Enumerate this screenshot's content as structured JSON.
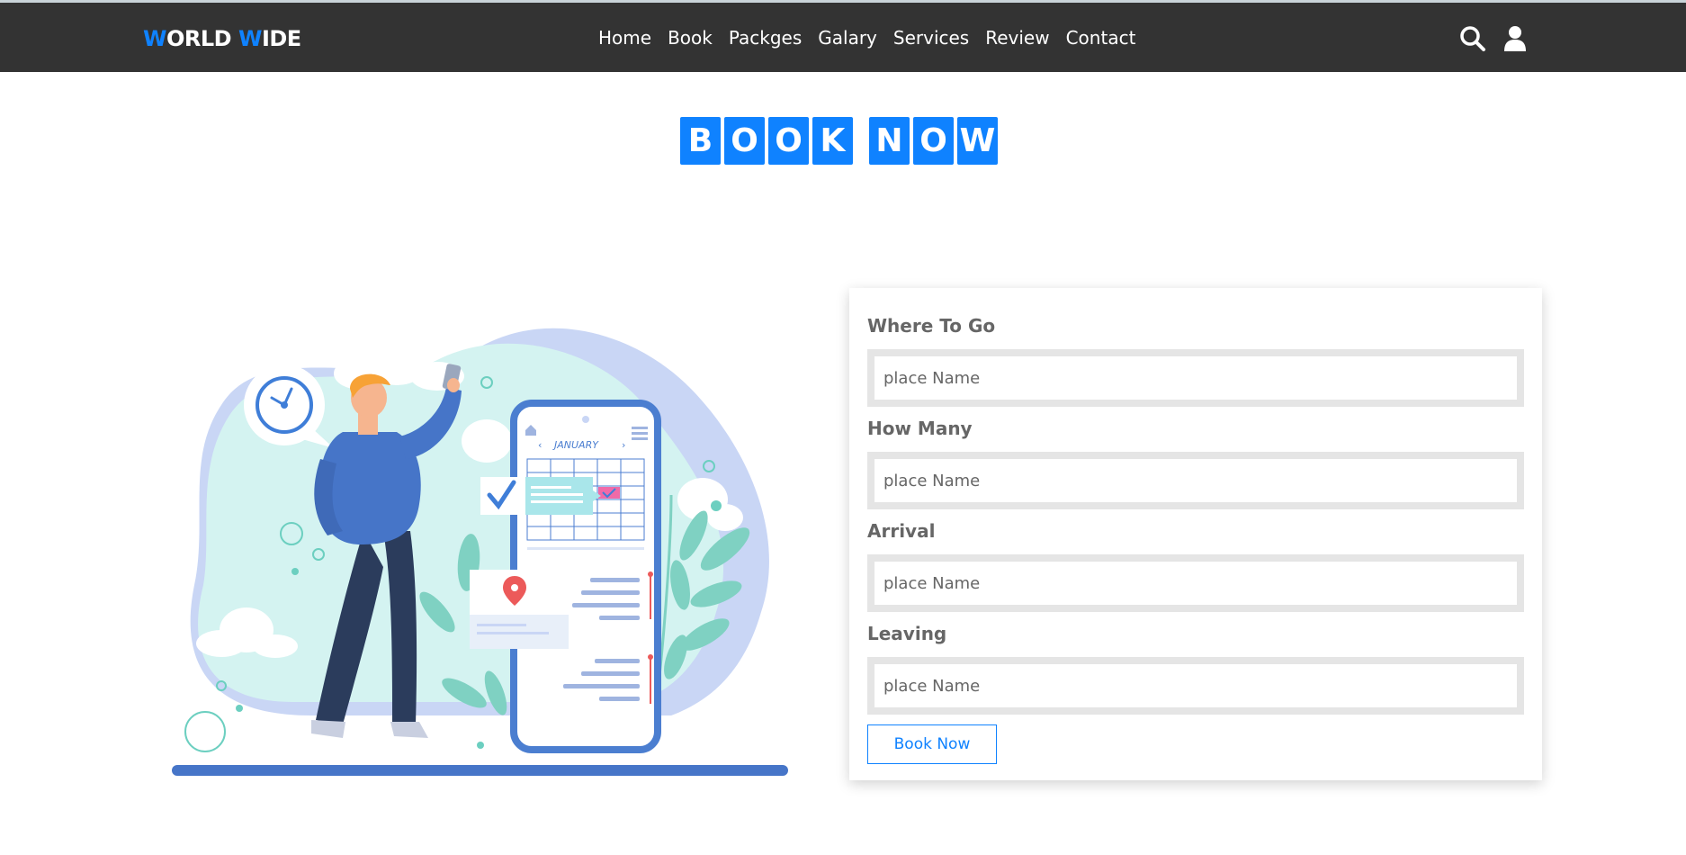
{
  "header": {
    "logo_first_initial": "W",
    "logo_first_rest": "ORLD",
    "logo_second_initial": "W",
    "logo_second_rest": "IDE",
    "nav": [
      "Home",
      "Book",
      "Packges",
      "Galary",
      "Services",
      "Review",
      "Contact"
    ],
    "icons": [
      "search-icon",
      "user-icon"
    ]
  },
  "page_title": {
    "word1": [
      "B",
      "O",
      "O",
      "K"
    ],
    "word2": [
      "N",
      "O",
      "W"
    ]
  },
  "illustration": {
    "calendar_month": "JANUARY"
  },
  "form": {
    "fields": [
      {
        "label": "Where To Go",
        "placeholder": "place Name"
      },
      {
        "label": "How Many",
        "placeholder": "place Name"
      },
      {
        "label": "Arrival",
        "placeholder": "place Name"
      },
      {
        "label": "Leaving",
        "placeholder": "place Name"
      }
    ],
    "submit_label": "Book Now"
  },
  "colors": {
    "accent": "#0f82ff",
    "header_bg": "#333333",
    "label": "#666666",
    "input_border": "#e5e5e5"
  }
}
